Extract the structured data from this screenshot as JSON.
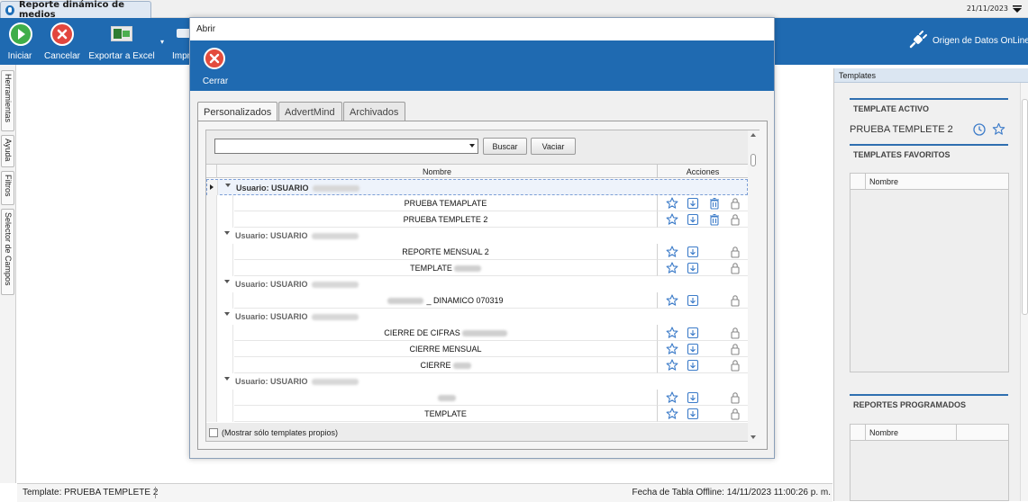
{
  "top_tab": {
    "label": "Reporte dinámico de medios"
  },
  "top_date": "21/11/2023",
  "ribbon": {
    "iniciar": "Iniciar",
    "cancelar": "Cancelar",
    "exportar": "Exportar a Excel",
    "imprimir": "Impr",
    "origen": "Origen de Datos OnLine"
  },
  "left_tabs": [
    "Herramientas",
    "Ayuda",
    "Filtros",
    "Selector de Campos"
  ],
  "right_panel": {
    "title": "Templates",
    "active_heading": "TEMPLATE ACTIVO",
    "active_name": "PRUEBA TEMPLETE 2",
    "favorites_heading": "TEMPLATES FAVORITOS",
    "favorites_col": "Nombre",
    "scheduled_heading": "REPORTES PROGRAMADOS",
    "scheduled_col": "Nombre"
  },
  "status": {
    "template": "Template: PRUEBA TEMPLETE 2",
    "fecha": "Fecha de Tabla Offline: 14/11/2023 11:00:26 p. m."
  },
  "dialog": {
    "title": "Abrir",
    "close_label": "Cerrar",
    "tabs": [
      "Personalizados",
      "AdvertMind",
      "Archivados"
    ],
    "search_value": "",
    "buscar": "Buscar",
    "vaciar": "Vaciar",
    "col_nombre": "Nombre",
    "col_acciones": "Acciones",
    "group_prefix": "Usuario: USUARIO",
    "rows": [
      {
        "name": "PRUEBA TEMAPLATE"
      },
      {
        "name": "PRUEBA TEMPLETE 2"
      },
      {
        "name": "REPORTE MENSUAL 2"
      },
      {
        "name": "TEMPLATE"
      },
      {
        "name": "_ DINAMICO 070319"
      },
      {
        "name": "CIERRE DE CIFRAS"
      },
      {
        "name": "CIERRE MENSUAL"
      },
      {
        "name": "CIERRE"
      },
      {
        "name": ""
      },
      {
        "name": "TEMPLATE"
      }
    ],
    "checkbox_label": "(Mostrar sólo templates propios)"
  },
  "colors": {
    "ribbon_blue": "#1f6ab1",
    "accent_blue": "#2f6fb0",
    "icon_blue": "#3d7cc9",
    "green": "#3fae49",
    "red": "#e2463e"
  }
}
